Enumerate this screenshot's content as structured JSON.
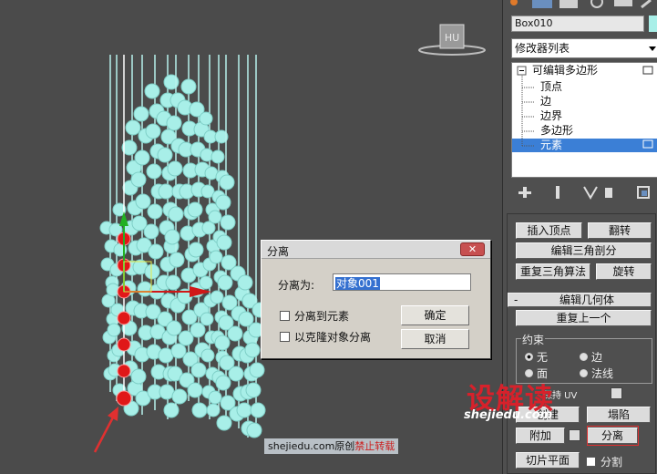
{
  "viewport": {
    "viewcube_label": "НU"
  },
  "dialog": {
    "title": "分离",
    "close_icon": "close-icon",
    "name_label": "分离为:",
    "name_value": "对象001",
    "checkbox_element": "分离到元素",
    "checkbox_clone": "以克隆对象分离",
    "ok_label": "确定",
    "cancel_label": "取消"
  },
  "panel": {
    "object_name": "Box010",
    "object_color": "#a8efe8",
    "modifier_list": "修改器列表",
    "stack": {
      "root": "可编辑多边形",
      "items": [
        "顶点",
        "边",
        "边界",
        "多边形",
        "元素"
      ],
      "selected_index": 4
    },
    "buttons": {
      "insert_vertex": "插入顶点",
      "flip": "翻转",
      "edit_triangulation": "编辑三角剖分",
      "retriangulate": "重复三角算法",
      "turn": "旋转",
      "repeat_last": "重复上一个",
      "create": "创建",
      "collapse": "塌陷",
      "attach": "附加",
      "detach": "分离",
      "slice_plane": "切片平面",
      "split": "分割",
      "preserve_uv": "保持 UV"
    },
    "rollout_edit_geometry": "编辑几何体",
    "rollout_toggle": "-",
    "constraints": {
      "label": "约束",
      "none": "无",
      "edge": "边",
      "face": "面",
      "normal": "法线"
    }
  },
  "watermark": {
    "logo": "设解读",
    "url": "shejiedu.com",
    "credit_prefix": "shejiedu.com原创",
    "credit_red": "禁止转载"
  },
  "colors": {
    "viewport_bg": "#4b4b4b",
    "bead": "#a8efe8",
    "selected_bead": "#e01818",
    "selection_blue": "#3b7fd6",
    "detach_highlight": "#e03030"
  }
}
